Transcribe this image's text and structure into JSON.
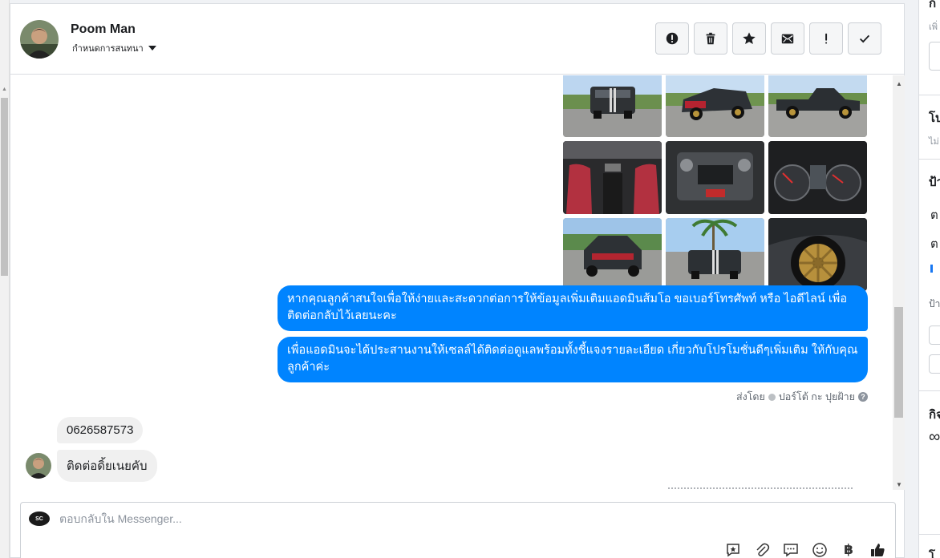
{
  "contact": {
    "name": "Poom Man",
    "assign_label": "กำหนดการสนทนา"
  },
  "actions": [
    {
      "name": "mark-spam-button",
      "icon": "alert-circle-icon"
    },
    {
      "name": "delete-button",
      "icon": "trash-icon"
    },
    {
      "name": "star-button",
      "icon": "star-icon"
    },
    {
      "name": "mark-unread-button",
      "icon": "envelope-icon"
    },
    {
      "name": "follow-up-button",
      "icon": "exclamation-icon"
    },
    {
      "name": "mark-done-button",
      "icon": "checkmark-icon"
    }
  ],
  "photos": [
    "truck-rear-view",
    "truck-front-three-quarter",
    "truck-side-view",
    "interior-seats",
    "engine-bay",
    "instrument-cluster",
    "truck-front-view",
    "truck-rear-palm-trees",
    "gold-wheel-closeup"
  ],
  "messages": {
    "outgoing": [
      "หากคุณลูกค้าสนใจเพื่อให้ง่ายและสะดวกต่อการให้ข้อมูลเพิ่มเติมแอดมินส้มโอ ขอเบอร์โทรศัพท์ หรือ ไอดีไลน์ เพื่อติดต่อกลับไว้เลยนะคะ",
      "เพื่อแอดมินจะได้ประสานงานให้เซลล์ได้ติดต่อดูแลพร้อมทั้งชี้แจงรายละเอียด เกี่ยวกับโปรโมชั่นดีๆเพิ่มเติม ให้กับคุณลูกค้าค่ะ"
    ],
    "sent_by_prefix": "ส่งโดย",
    "sent_by_name": "ปอร์โต้ กะ ปุยฝ้าย",
    "incoming": [
      "0626587573",
      "ติดต่อดิ้ยเนยคับ"
    ]
  },
  "reply": {
    "page_logo_text": "SC",
    "placeholder": "ตอบกลับใน Messenger..."
  },
  "reply_tools": [
    "saved-reply-icon",
    "attachment-icon",
    "chat-bubble-icon",
    "emoji-icon",
    "baht-payment-icon",
    "thumbs-up-icon"
  ],
  "sidebar": {
    "section1_title": "ก",
    "section1_sub": "เพิ่",
    "section2_title": "โป",
    "section2_sub": "ไม่",
    "section3_title": "ป้า",
    "section3_row1": "ต",
    "section3_row2": "ต",
    "section3_sub": "ป้า",
    "section4_title": "กิจ",
    "section4_glyph": "∞",
    "section5_title": "โ"
  },
  "colors": {
    "outgoing_bubble": "#0084ff",
    "incoming_bubble": "#f0f0f0",
    "background": "#f0f2f5"
  }
}
